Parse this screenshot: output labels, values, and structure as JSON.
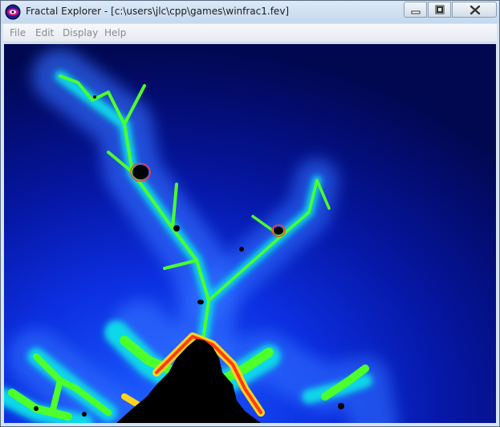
{
  "window": {
    "title": "Fractal Explorer - [c:\\users\\jlc\\cpp\\games\\winfrac1.fev]"
  },
  "icons": {
    "app": "fractal-app-icon",
    "minimize": "minimize-icon",
    "maximize": "maximize-icon",
    "close": "close-icon"
  },
  "menu": {
    "items": [
      {
        "label": "File"
      },
      {
        "label": "Edit"
      },
      {
        "label": "Display"
      },
      {
        "label": "Help"
      }
    ]
  },
  "canvas": {
    "description_colors": {
      "deep": "#000a55",
      "mid": "#0a2ad8",
      "light": "#3c7cff",
      "glow": "#00e8e0",
      "green": "#46ff2a",
      "yellow": "#ffee22",
      "red": "#ff2020",
      "set": "#000000"
    }
  }
}
